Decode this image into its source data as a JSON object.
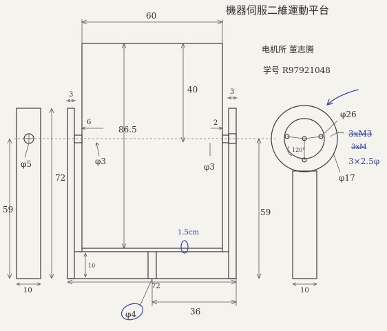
{
  "title": "機器伺服二維運動平台",
  "author": "电机所 董志腾",
  "student_id": "学号 R97921048",
  "dimensions": {
    "top_width": "60",
    "upper_height": "40",
    "inner_height": "86.5",
    "side_thickness_left": "3",
    "side_thickness_right": "3",
    "left_pin_len": "6",
    "right_pin_len": "2",
    "pin_left_dia": "φ3",
    "pin_right_dia": "φ3",
    "left_post_height": "72",
    "left_overall": "59",
    "left_hole": "φ5",
    "left_base_width": "10",
    "base_height": "10",
    "overall_width": "72",
    "bottom_bore": "φ4",
    "bore_offset": "36",
    "right_post_height": "59",
    "right_base_width": "10",
    "circle_bolt": "φ26",
    "circle_outer": "φ17",
    "bolt_spec_struck": "3xM3",
    "bolt_spec_struck_2": "3xM",
    "bolt_spec": "3×2.5φ",
    "angle": "120°",
    "note_blue": "1.5cm"
  }
}
